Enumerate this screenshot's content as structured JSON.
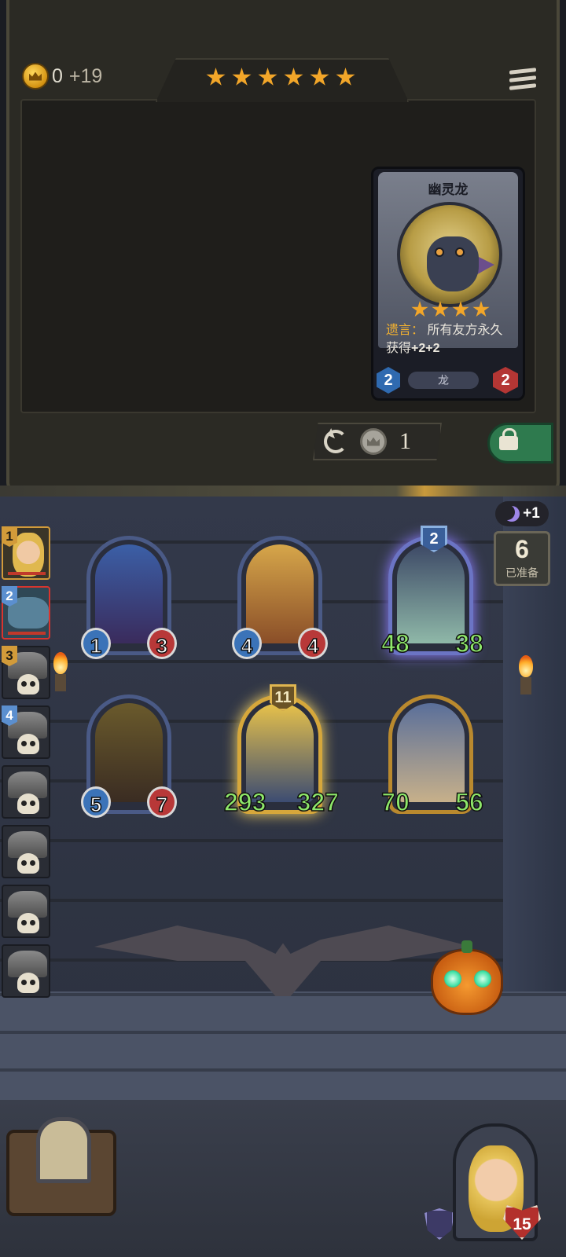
{
  "shop": {
    "gold": "0",
    "gold_income": "+19",
    "tavern_stars": 6,
    "refresh_cost": "1"
  },
  "card_preview": {
    "name": "幽灵龙",
    "stars": 4,
    "keyword": "遗言",
    "keyword_sep": "：",
    "effect_part1": "所有友方永久获得",
    "effect_bold": "+2+2",
    "tribe": "龙",
    "attack": "2",
    "health": "2"
  },
  "lobby": {
    "ready_count": "6",
    "ready_label": "已准备",
    "moon_bonus": "+1",
    "players": [
      {
        "rank": "1",
        "state": "self"
      },
      {
        "rank": "2",
        "state": "target"
      },
      {
        "rank": "3",
        "state": "dead"
      },
      {
        "rank": "4",
        "state": "dead"
      },
      {
        "rank": "",
        "state": "dead"
      },
      {
        "rank": "",
        "state": "dead"
      },
      {
        "rank": "",
        "state": "dead"
      },
      {
        "rank": "",
        "state": "dead"
      }
    ]
  },
  "board": {
    "row1": [
      {
        "name": "blue-haired-elf",
        "attack": "1",
        "health": "3",
        "buffed": false
      },
      {
        "name": "golden-knight",
        "attack": "4",
        "health": "4",
        "buffed": false
      },
      {
        "name": "spectral-horse",
        "attack": "48",
        "health": "38",
        "buffed": true,
        "tier": "2"
      }
    ],
    "row2": [
      {
        "name": "hat-wizard",
        "attack": "5",
        "health": "7",
        "buffed": false
      },
      {
        "name": "blond-hero",
        "attack": "293",
        "health": "327",
        "buffed": true,
        "tier": "11"
      },
      {
        "name": "dwarf-king",
        "attack": "70",
        "health": "56",
        "buffed": true
      }
    ]
  },
  "hero": {
    "health": "15"
  }
}
